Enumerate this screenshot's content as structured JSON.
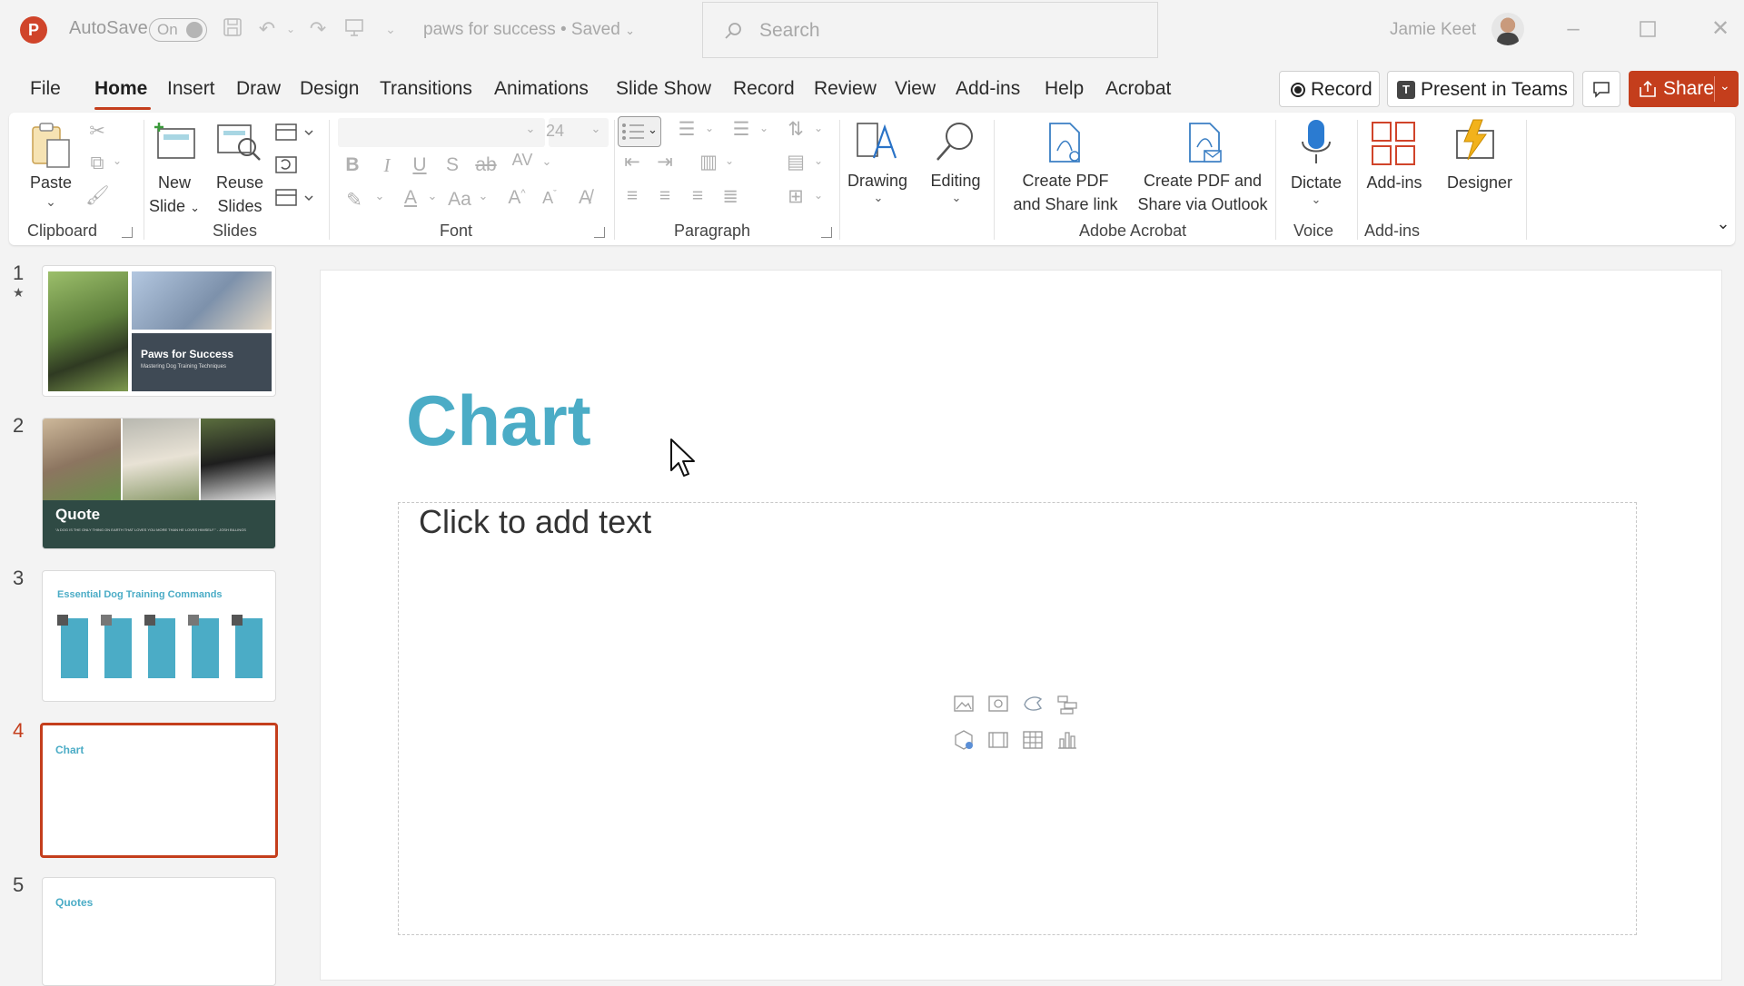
{
  "titlebar": {
    "app_logo": "P",
    "autosave_label": "AutoSave",
    "autosave_state": "On",
    "document_title": "paws for success • Saved",
    "search_placeholder": "Search",
    "user_name": "Jamie Keet"
  },
  "menu": {
    "items": [
      "File",
      "Home",
      "Insert",
      "Draw",
      "Design",
      "Transitions",
      "Animations",
      "Slide Show",
      "Record",
      "Review",
      "View",
      "Add-ins",
      "Help",
      "Acrobat"
    ],
    "active": "Home",
    "record_label": "Record",
    "teams_label": "Present in Teams",
    "share_label": "Share"
  },
  "ribbon": {
    "clipboard": {
      "paste": "Paste",
      "group": "Clipboard"
    },
    "slides": {
      "new_slide_1": "New",
      "new_slide_2": "Slide",
      "reuse_1": "Reuse",
      "reuse_2": "Slides",
      "group": "Slides"
    },
    "font": {
      "size": "24",
      "group": "Font"
    },
    "paragraph": {
      "group": "Paragraph"
    },
    "drawing": "Drawing",
    "editing": "Editing",
    "acrobat": {
      "create_link_1": "Create PDF",
      "create_link_2": "and Share link",
      "create_outlook_1": "Create PDF and",
      "create_outlook_2": "Share via Outlook",
      "group": "Adobe Acrobat"
    },
    "voice": {
      "dictate": "Dictate",
      "group": "Voice"
    },
    "addins": {
      "label": "Add-ins",
      "group": "Add-ins"
    },
    "designer": "Designer"
  },
  "slides": [
    {
      "number": "1",
      "title": "Paws for Success",
      "subtitle": "Mastering Dog Training Techniques"
    },
    {
      "number": "2",
      "title": "Quote",
      "subtitle": "“A DOG IS THE ONLY THING ON EARTH THAT LOVES YOU MORE THAN HE LOVES HIMSELF.” - JOSH BILLINGS"
    },
    {
      "number": "3",
      "title": "Essential Dog Training Commands"
    },
    {
      "number": "4",
      "title": "Chart"
    },
    {
      "number": "5",
      "title": "Quotes"
    }
  ],
  "selected_slide": "4",
  "canvas": {
    "title": "Chart",
    "placeholder": "Click to add text"
  },
  "colors": {
    "accent": "#c43e1c",
    "slide_title": "#4bacc6",
    "ribbon_bg": "#ffffff"
  }
}
